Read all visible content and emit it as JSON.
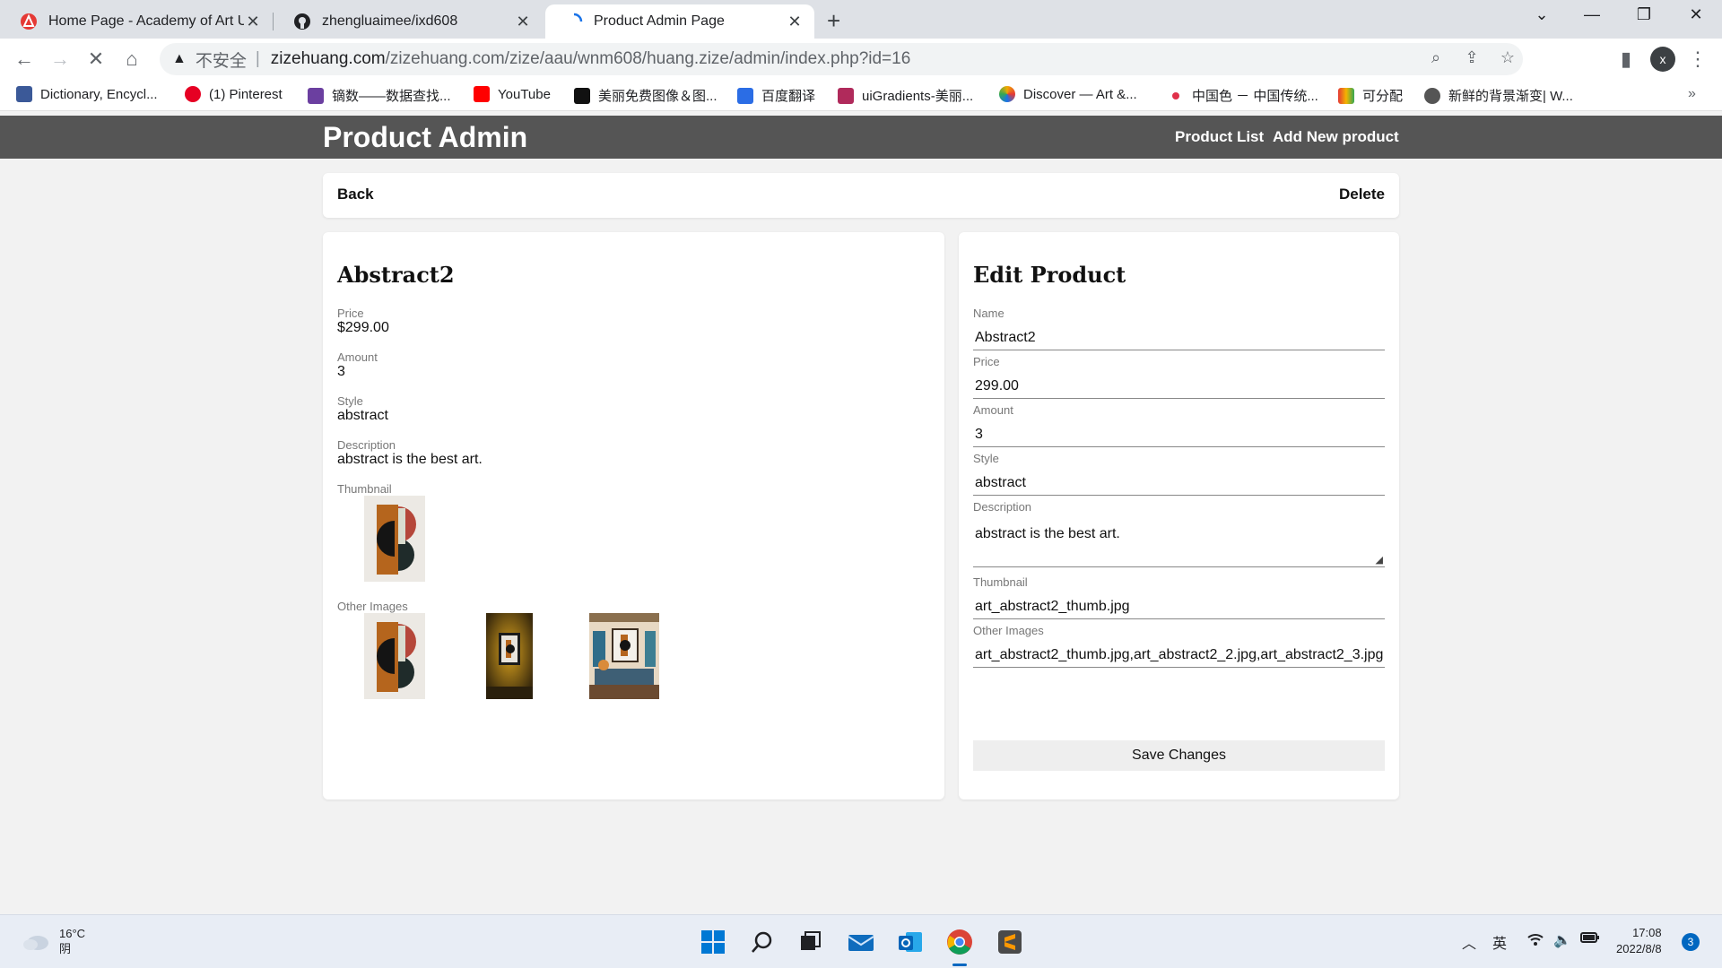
{
  "browser": {
    "tabs": [
      {
        "title": "Home Page - Academy of Art U",
        "icon": "academy-icon"
      },
      {
        "title": "zhengluaimee/ixd608",
        "icon": "github-icon"
      },
      {
        "title": "Product Admin Page",
        "icon": "loading-spinner-icon"
      }
    ],
    "omnibox": {
      "security_label": "不安全",
      "url_host": "zizehuang.com",
      "url_path": "/zizehuang.com/zize/aau/wnm608/huang.zize/admin/index.php?id=16"
    },
    "profile_initial": "x",
    "bookmarks": [
      {
        "label": "Dictionary, Encycl...",
        "color": "#3b5998"
      },
      {
        "label": "(1) Pinterest",
        "color": "#e60023"
      },
      {
        "label": "镝数——数据查找...",
        "color": "#6b3fa0"
      },
      {
        "label": "YouTube",
        "color": "#ff0000"
      },
      {
        "label": "美丽免费图像＆图...",
        "color": "#111111"
      },
      {
        "label": "百度翻译",
        "color": "#2b6de5"
      },
      {
        "label": "uiGradients-美丽...",
        "color": "#b02a5b"
      },
      {
        "label": "Discover — Art &...",
        "color": "#f2a900"
      },
      {
        "label": "中国色 － 中国传统...",
        "color": "#e0304a"
      },
      {
        "label": "可分配",
        "color": "#f4b400"
      },
      {
        "label": "新鲜的背景渐变| W...",
        "color": "#555555"
      }
    ],
    "bookmarks_more": "»"
  },
  "site": {
    "brand": "Product Admin",
    "nav": {
      "list": "Product List",
      "add": "Add New product"
    }
  },
  "page": {
    "back": "Back",
    "delete": "Delete"
  },
  "product": {
    "name": "Abstract2",
    "price_label": "Price",
    "price": "$299.00",
    "amount_label": "Amount",
    "amount": "3",
    "style_label": "Style",
    "style": "abstract",
    "description_label": "Description",
    "description": "abstract is the best art.",
    "thumbnail_label": "Thumbnail",
    "other_images_label": "Other Images"
  },
  "form": {
    "title": "Edit Product",
    "name_label": "Name",
    "name_value": "Abstract2",
    "price_label": "Price",
    "price_value": "299.00",
    "amount_label": "Amount",
    "amount_value": "3",
    "style_label": "Style",
    "style_value": "abstract",
    "description_label": "Description",
    "description_value": "abstract is the best art.",
    "thumbnail_label": "Thumbnail",
    "thumbnail_value": "art_abstract2_thumb.jpg",
    "images_label": "Other Images",
    "images_value": "art_abstract2_thumb.jpg,art_abstract2_2.jpg,art_abstract2_3.jpg",
    "save_label": "Save Changes"
  },
  "taskbar": {
    "temperature": "16°C",
    "condition": "阴",
    "ime": "英",
    "time": "17:08",
    "date": "2022/8/8",
    "notifications": "3"
  }
}
